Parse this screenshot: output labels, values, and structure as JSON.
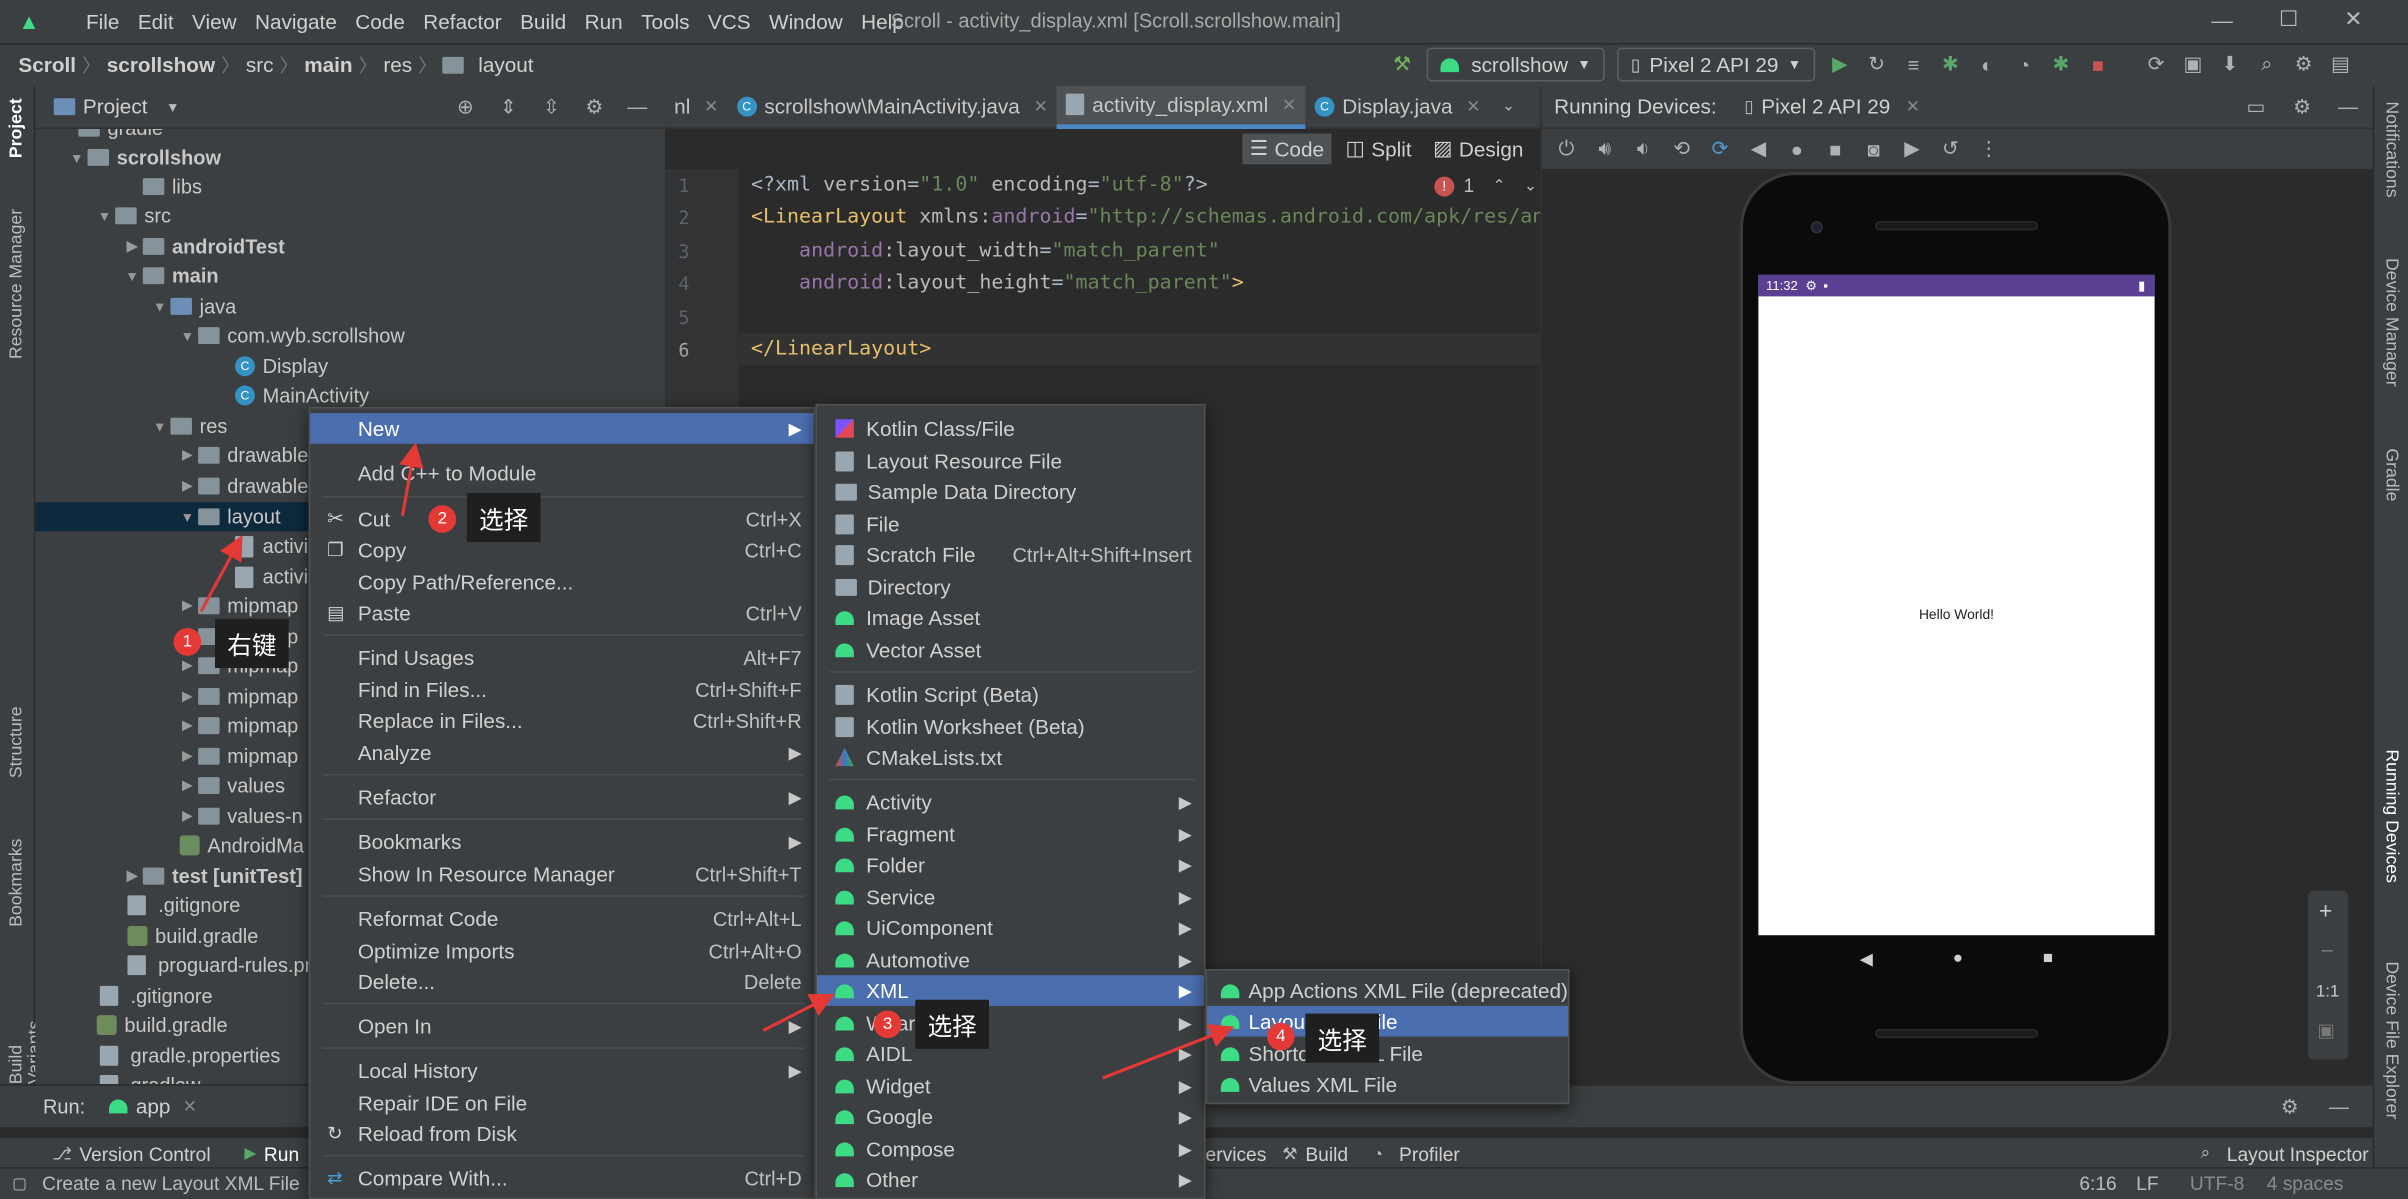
{
  "menubar": {
    "items": [
      "File",
      "Edit",
      "View",
      "Navigate",
      "Code",
      "Refactor",
      "Build",
      "Run",
      "Tools",
      "VCS",
      "Window",
      "Help"
    ],
    "title": "Scroll - activity_display.xml [Scroll.scrollshow.main]"
  },
  "navbar": {
    "crumbs": [
      "Scroll",
      "scrollshow",
      "src",
      "main",
      "res",
      "layout"
    ],
    "run_config": "scrollshow",
    "device": "Pixel 2 API 29"
  },
  "left_strip": [
    "Project",
    "Resource Manager",
    "Structure",
    "Bookmarks",
    "Build Variants"
  ],
  "right_strip": [
    "Notifications",
    "Device Manager",
    "Gradle",
    "Running Devices",
    "Device File Explorer"
  ],
  "project_panel": {
    "title": "Project",
    "tree": [
      {
        "label": "gradle",
        "depth": 1
      },
      {
        "label": "scrollshow",
        "depth": 1
      },
      {
        "label": "libs",
        "depth": 2
      },
      {
        "label": "src",
        "depth": 2
      },
      {
        "label": "androidTest",
        "depth": 3
      },
      {
        "label": "main",
        "depth": 3
      },
      {
        "label": "java",
        "depth": 4
      },
      {
        "label": "com.wyb.scrollshow",
        "depth": 5
      },
      {
        "label": "Display",
        "depth": 6
      },
      {
        "label": "MainActivity",
        "depth": 6
      },
      {
        "label": "res",
        "depth": 4
      },
      {
        "label": "drawable",
        "depth": 5
      },
      {
        "label": "drawable",
        "depth": 5
      },
      {
        "label": "layout",
        "depth": 5
      },
      {
        "label": "activi",
        "depth": 6
      },
      {
        "label": "activi",
        "depth": 6
      },
      {
        "label": "mipmap",
        "depth": 5
      },
      {
        "label": "mipmap",
        "depth": 5
      },
      {
        "label": "mipmap",
        "depth": 5
      },
      {
        "label": "mipmap",
        "depth": 5
      },
      {
        "label": "mipmap",
        "depth": 5
      },
      {
        "label": "mipmap",
        "depth": 5
      },
      {
        "label": "values",
        "depth": 5
      },
      {
        "label": "values-n",
        "depth": 5
      },
      {
        "label": "AndroidMa",
        "depth": 4
      },
      {
        "label": "test [unitTest]",
        "depth": 3
      },
      {
        "label": ".gitignore",
        "depth": 2
      },
      {
        "label": "build.gradle",
        "depth": 2
      },
      {
        "label": "proguard-rules.pr",
        "depth": 2
      },
      {
        "label": ".gitignore",
        "depth": 1
      },
      {
        "label": "build.gradle",
        "depth": 1
      },
      {
        "label": "gradle.properties",
        "depth": 1
      },
      {
        "label": "gradlew",
        "depth": 1
      }
    ]
  },
  "editor": {
    "tabs": [
      "nl",
      "scrollshow\\MainActivity.java",
      "activity_display.xml",
      "Display.java"
    ],
    "view_modes": [
      "Code",
      "Split",
      "Design"
    ],
    "line_numbers": [
      "1",
      "2",
      "3",
      "4",
      "5",
      "6"
    ],
    "error_count": "1",
    "lines": [
      {
        "seg": [
          "<?xml ",
          "version",
          "=",
          "\"1.0\"",
          " encoding",
          "=",
          "\"utf-8\"",
          "?>"
        ]
      },
      {
        "seg": [
          "<LinearLayout ",
          "xmlns:",
          "android",
          "=",
          "\"http://schemas.android.com/apk/res/an"
        ]
      },
      {
        "seg": [
          "    ",
          "android",
          ":layout_width",
          "=",
          "\"match_parent\""
        ]
      },
      {
        "seg": [
          "    ",
          "android",
          ":layout_height",
          "=",
          "\"match_parent\"",
          ">"
        ]
      },
      {
        "seg": [
          ""
        ]
      },
      {
        "seg": [
          "</LinearLayout>"
        ]
      }
    ]
  },
  "devices": {
    "title": "Running Devices:",
    "device_tab": "Pixel 2 API 29",
    "clock": "11:32",
    "screen_text": "Hello World!",
    "zoom_label": "1:1"
  },
  "context_menu": {
    "items": [
      {
        "label": "New",
        "shortcut": "",
        "sub": true,
        "highlight": true
      },
      {
        "label": "Add C++ to Module",
        "shortcut": "",
        "sub": false
      },
      {
        "label": "Cut",
        "shortcut": "Ctrl+X",
        "sub": false
      },
      {
        "label": "Copy",
        "shortcut": "Ctrl+C",
        "sub": false
      },
      {
        "label": "Copy Path/Reference...",
        "shortcut": "",
        "sub": false
      },
      {
        "label": "Paste",
        "shortcut": "Ctrl+V",
        "sub": false
      },
      {
        "label": "Find Usages",
        "shortcut": "Alt+F7",
        "sub": false
      },
      {
        "label": "Find in Files...",
        "shortcut": "Ctrl+Shift+F",
        "sub": false
      },
      {
        "label": "Replace in Files...",
        "shortcut": "Ctrl+Shift+R",
        "sub": false
      },
      {
        "label": "Analyze",
        "shortcut": "",
        "sub": true
      },
      {
        "label": "Refactor",
        "shortcut": "",
        "sub": true
      },
      {
        "label": "Bookmarks",
        "shortcut": "",
        "sub": true
      },
      {
        "label": "Show In Resource Manager",
        "shortcut": "Ctrl+Shift+T",
        "sub": false
      },
      {
        "label": "Reformat Code",
        "shortcut": "Ctrl+Alt+L",
        "sub": false
      },
      {
        "label": "Optimize Imports",
        "shortcut": "Ctrl+Alt+O",
        "sub": false
      },
      {
        "label": "Delete...",
        "shortcut": "Delete",
        "sub": false
      },
      {
        "label": "Open In",
        "shortcut": "",
        "sub": true
      },
      {
        "label": "Local History",
        "shortcut": "",
        "sub": true
      },
      {
        "label": "Repair IDE on File",
        "shortcut": "",
        "sub": false
      },
      {
        "label": "Reload from Disk",
        "shortcut": "",
        "sub": false
      },
      {
        "label": "Compare With...",
        "shortcut": "Ctrl+D",
        "sub": false
      }
    ]
  },
  "new_menu": {
    "items": [
      {
        "label": "Kotlin Class/File",
        "shortcut": ""
      },
      {
        "label": "Layout Resource File",
        "shortcut": ""
      },
      {
        "label": "Sample Data Directory",
        "shortcut": ""
      },
      {
        "label": "File",
        "shortcut": ""
      },
      {
        "label": "Scratch File",
        "shortcut": "Ctrl+Alt+Shift+Insert"
      },
      {
        "label": "Directory",
        "shortcut": ""
      },
      {
        "label": "Image Asset",
        "shortcut": ""
      },
      {
        "label": "Vector Asset",
        "shortcut": ""
      },
      {
        "label": "Kotlin Script (Beta)",
        "shortcut": ""
      },
      {
        "label": "Kotlin Worksheet (Beta)",
        "shortcut": ""
      },
      {
        "label": "CMakeLists.txt",
        "shortcut": ""
      },
      {
        "label": "Activity",
        "shortcut": ""
      },
      {
        "label": "Fragment",
        "shortcut": ""
      },
      {
        "label": "Folder",
        "shortcut": ""
      },
      {
        "label": "Service",
        "shortcut": ""
      },
      {
        "label": "UiComponent",
        "shortcut": ""
      },
      {
        "label": "Automotive",
        "shortcut": ""
      },
      {
        "label": "XML",
        "shortcut": ""
      },
      {
        "label": "Wear",
        "shortcut": ""
      },
      {
        "label": "AIDL",
        "shortcut": ""
      },
      {
        "label": "Widget",
        "shortcut": ""
      },
      {
        "label": "Google",
        "shortcut": ""
      },
      {
        "label": "Compose",
        "shortcut": ""
      },
      {
        "label": "Other",
        "shortcut": ""
      }
    ]
  },
  "xml_menu": {
    "items": [
      "App Actions XML File (deprecated)",
      "Layout XML File",
      "Shortcuts XML File",
      "Values XML File"
    ]
  },
  "annotations": [
    {
      "num": "1",
      "text": "右键"
    },
    {
      "num": "2",
      "text": "选择"
    },
    {
      "num": "3",
      "text": "选择"
    },
    {
      "num": "4",
      "text": "选择"
    }
  ],
  "bottom": {
    "run_label": "Run:",
    "run_config": "app",
    "tool_tabs": [
      "Version Control",
      "Run",
      "ervices",
      "Build",
      "Profiler"
    ],
    "layout_inspector": "Layout Inspector",
    "status_text": "Create a new Layout XML File",
    "position": "6:16",
    "line_sep": "LF",
    "encoding": "UTF-8",
    "indent": "4 spaces"
  },
  "colors": {
    "accent": "#4b6eaf",
    "badge": "#e53935",
    "android_green": "#3ddc84",
    "status_bar": "#5a3f93"
  }
}
